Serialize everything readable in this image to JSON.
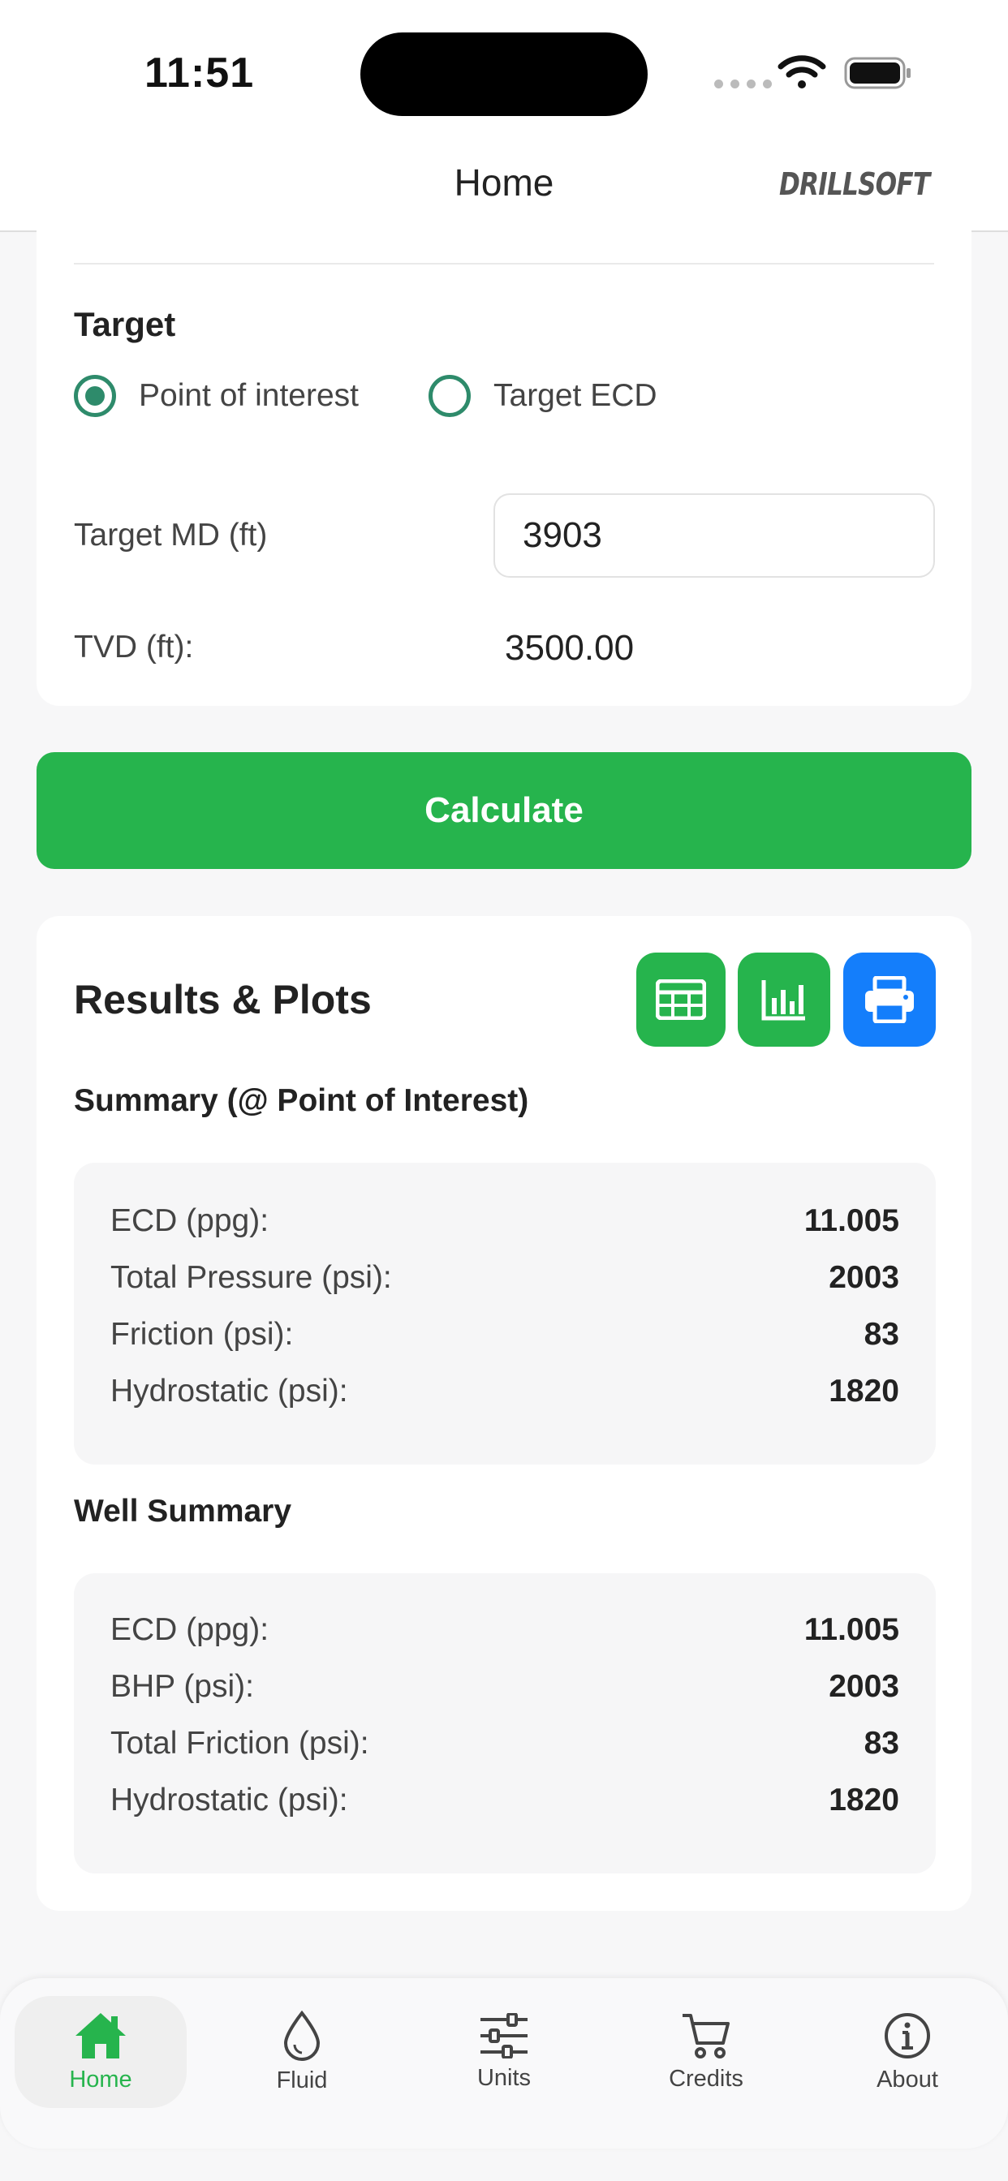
{
  "status_bar": {
    "time": "11:51"
  },
  "header": {
    "title": "Home",
    "brand": "DRILLSOFT"
  },
  "target": {
    "section_label": "Target",
    "radio_options": [
      {
        "label": "Point of interest",
        "selected": true
      },
      {
        "label": "Target ECD",
        "selected": false
      }
    ],
    "md_label": "Target MD (ft)",
    "md_value": "3903",
    "tvd_label": "TVD (ft):",
    "tvd_value": "3500.00"
  },
  "calculate_label": "Calculate",
  "results": {
    "title": "Results & Plots",
    "poi_title": "Summary (@ Point of Interest)",
    "poi_rows": [
      {
        "label": "ECD (ppg):",
        "value": "11.005"
      },
      {
        "label": "Total Pressure (psi):",
        "value": "2003"
      },
      {
        "label": "Friction (psi):",
        "value": "83"
      },
      {
        "label": "Hydrostatic (psi):",
        "value": "1820"
      }
    ],
    "well_title": "Well Summary",
    "well_rows": [
      {
        "label": "ECD (ppg):",
        "value": "11.005"
      },
      {
        "label": "BHP (psi):",
        "value": "2003"
      },
      {
        "label": "Total Friction (psi):",
        "value": "83"
      },
      {
        "label": "Hydrostatic (psi):",
        "value": "1820"
      }
    ]
  },
  "tabs": [
    {
      "label": "Home",
      "icon": "home-icon",
      "active": true
    },
    {
      "label": "Fluid",
      "icon": "drop-icon",
      "active": false
    },
    {
      "label": "Units",
      "icon": "sliders-icon",
      "active": false
    },
    {
      "label": "Credits",
      "icon": "cart-icon",
      "active": false
    },
    {
      "label": "About",
      "icon": "info-icon",
      "active": false
    }
  ],
  "colors": {
    "accent_green": "#26b44d",
    "radio_green": "#2e8b6b",
    "print_blue": "#147efb"
  }
}
